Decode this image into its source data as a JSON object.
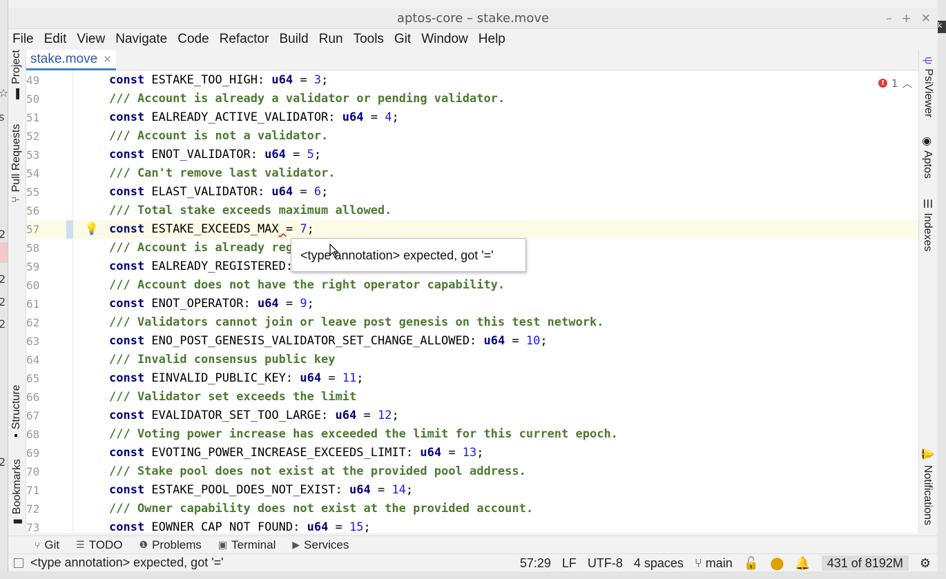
{
  "window": {
    "title": "aptos-core – stake.move"
  },
  "menu": [
    "File",
    "Edit",
    "View",
    "Navigate",
    "Code",
    "Refactor",
    "Build",
    "Run",
    "Tools",
    "Git",
    "Window",
    "Help"
  ],
  "left_tools": {
    "project": "Project",
    "pull_requests": "Pull Requests",
    "structure": "Structure",
    "bookmarks": "Bookmarks"
  },
  "right_tools": {
    "psiviewer": "PsiViewer",
    "aptos": "Aptos",
    "indexes": "Indexes",
    "notifications": "Notifications"
  },
  "tab": {
    "name": "stake.move"
  },
  "inspection": {
    "error_count": "1"
  },
  "editor": {
    "lines": [
      {
        "n": "49",
        "t": [
          [
            "kw",
            "const "
          ],
          [
            "id",
            "ESTAKE_TOO_HIGH: "
          ],
          [
            "kw",
            "u64"
          ],
          [
            "id",
            " = "
          ],
          [
            "num",
            "3"
          ],
          [
            "id",
            ";"
          ]
        ]
      },
      {
        "n": "50",
        "t": [
          [
            "cm",
            "/// Account is already a validator or pending validator."
          ]
        ]
      },
      {
        "n": "51",
        "t": [
          [
            "kw",
            "const "
          ],
          [
            "id",
            "EALREADY_ACTIVE_VALIDATOR: "
          ],
          [
            "kw",
            "u64"
          ],
          [
            "id",
            " = "
          ],
          [
            "num",
            "4"
          ],
          [
            "id",
            ";"
          ]
        ]
      },
      {
        "n": "52",
        "t": [
          [
            "cm",
            "/// Account is not a validator."
          ]
        ]
      },
      {
        "n": "53",
        "t": [
          [
            "kw",
            "const "
          ],
          [
            "id",
            "ENOT_VALIDATOR: "
          ],
          [
            "kw",
            "u64"
          ],
          [
            "id",
            " = "
          ],
          [
            "num",
            "5"
          ],
          [
            "id",
            ";"
          ]
        ]
      },
      {
        "n": "54",
        "t": [
          [
            "cm",
            "/// Can't remove last validator."
          ]
        ]
      },
      {
        "n": "55",
        "t": [
          [
            "kw",
            "const "
          ],
          [
            "id",
            "ELAST_VALIDATOR: "
          ],
          [
            "kw",
            "u64"
          ],
          [
            "id",
            " = "
          ],
          [
            "num",
            "6"
          ],
          [
            "id",
            ";"
          ]
        ]
      },
      {
        "n": "56",
        "t": [
          [
            "cm",
            "/// Total stake exceeds maximum allowed."
          ]
        ]
      },
      {
        "n": "57",
        "current": true,
        "t": [
          [
            "kw",
            "const "
          ],
          [
            "id",
            "ESTAKE_EXCEEDS_MAX"
          ],
          [
            "sq",
            " "
          ],
          [
            "id",
            "= "
          ],
          [
            "num",
            "7"
          ],
          [
            "id",
            ";"
          ]
        ]
      },
      {
        "n": "58",
        "t": [
          [
            "cm",
            "/// Account is already registered as a validator candidate."
          ]
        ]
      },
      {
        "n": "59",
        "t": [
          [
            "kw",
            "const "
          ],
          [
            "id",
            "EALREADY_REGISTERED: "
          ],
          [
            "kw",
            "u64"
          ],
          [
            "id",
            " = "
          ],
          [
            "num",
            "8"
          ],
          [
            "id",
            ";"
          ]
        ]
      },
      {
        "n": "60",
        "t": [
          [
            "cm",
            "/// Account does not have the right operator capability."
          ]
        ]
      },
      {
        "n": "61",
        "t": [
          [
            "kw",
            "const "
          ],
          [
            "id",
            "ENOT_OPERATOR: "
          ],
          [
            "kw",
            "u64"
          ],
          [
            "id",
            " = "
          ],
          [
            "num",
            "9"
          ],
          [
            "id",
            ";"
          ]
        ]
      },
      {
        "n": "62",
        "t": [
          [
            "cm",
            "/// Validators cannot join or leave post genesis on this test network."
          ]
        ]
      },
      {
        "n": "63",
        "t": [
          [
            "kw",
            "const "
          ],
          [
            "id",
            "ENO_POST_GENESIS_VALIDATOR_SET_CHANGE_ALLOWED: "
          ],
          [
            "kw",
            "u64"
          ],
          [
            "id",
            " = "
          ],
          [
            "num",
            "10"
          ],
          [
            "id",
            ";"
          ]
        ]
      },
      {
        "n": "64",
        "t": [
          [
            "cm",
            "/// Invalid consensus public key"
          ]
        ]
      },
      {
        "n": "65",
        "t": [
          [
            "kw",
            "const "
          ],
          [
            "id",
            "EINVALID_PUBLIC_KEY: "
          ],
          [
            "kw",
            "u64"
          ],
          [
            "id",
            " = "
          ],
          [
            "num",
            "11"
          ],
          [
            "id",
            ";"
          ]
        ]
      },
      {
        "n": "66",
        "t": [
          [
            "cm",
            "/// Validator set exceeds the limit"
          ]
        ]
      },
      {
        "n": "67",
        "t": [
          [
            "kw",
            "const "
          ],
          [
            "id",
            "EVALIDATOR_SET_TOO_LARGE: "
          ],
          [
            "kw",
            "u64"
          ],
          [
            "id",
            " = "
          ],
          [
            "num",
            "12"
          ],
          [
            "id",
            ";"
          ]
        ]
      },
      {
        "n": "68",
        "t": [
          [
            "cm",
            "/// Voting power increase has exceeded the limit for this current epoch."
          ]
        ]
      },
      {
        "n": "69",
        "t": [
          [
            "kw",
            "const "
          ],
          [
            "id",
            "EVOTING_POWER_INCREASE_EXCEEDS_LIMIT: "
          ],
          [
            "kw",
            "u64"
          ],
          [
            "id",
            " = "
          ],
          [
            "num",
            "13"
          ],
          [
            "id",
            ";"
          ]
        ]
      },
      {
        "n": "70",
        "t": [
          [
            "cm",
            "/// Stake pool does not exist at the provided pool address."
          ]
        ]
      },
      {
        "n": "71",
        "t": [
          [
            "kw",
            "const "
          ],
          [
            "id",
            "ESTAKE_POOL_DOES_NOT_EXIST: "
          ],
          [
            "kw",
            "u64"
          ],
          [
            "id",
            " = "
          ],
          [
            "num",
            "14"
          ],
          [
            "id",
            ";"
          ]
        ]
      },
      {
        "n": "72",
        "t": [
          [
            "cm",
            "/// Owner capability does not exist at the provided account."
          ]
        ]
      },
      {
        "n": "73",
        "t": [
          [
            "kw",
            "const "
          ],
          [
            "id",
            "EOWNER_CAP_NOT_FOUND: "
          ],
          [
            "kw",
            "u64"
          ],
          [
            "id",
            " = "
          ],
          [
            "num",
            "15"
          ],
          [
            "id",
            ";"
          ]
        ]
      }
    ]
  },
  "tooltip": {
    "text": "<type annotation> expected, got '='"
  },
  "bottom_tools": [
    "Git",
    "TODO",
    "Problems",
    "Terminal",
    "Services"
  ],
  "status": {
    "message": "<type annotation> expected, got '='",
    "position": "57:29",
    "line_sep": "LF",
    "encoding": "UTF-8",
    "indent": "4 spaces",
    "branch": "main",
    "memory": "431 of 8192M"
  }
}
